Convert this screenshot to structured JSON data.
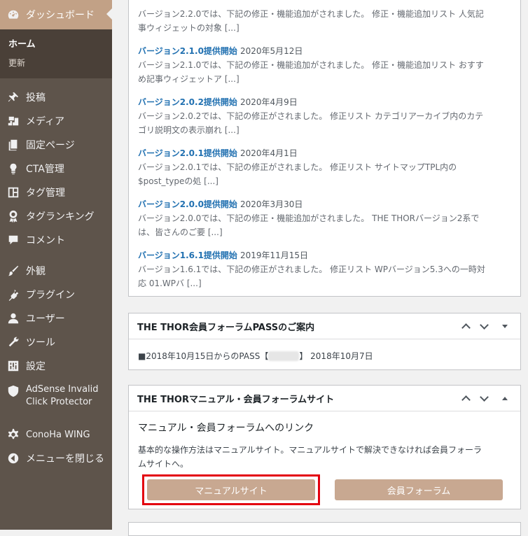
{
  "sidebar": {
    "dashboard": "ダッシュボード",
    "sub_home": "ホーム",
    "sub_update": "更新",
    "items": [
      {
        "label": "投稿",
        "icon": "pin-icon"
      },
      {
        "label": "メディア",
        "icon": "media-icon"
      },
      {
        "label": "固定ページ",
        "icon": "page-icon"
      },
      {
        "label": "CTA管理",
        "icon": "lightbulb-icon"
      },
      {
        "label": "タグ管理",
        "icon": "tag-icon"
      },
      {
        "label": "タグランキング",
        "icon": "award-icon"
      },
      {
        "label": "コメント",
        "icon": "comment-icon"
      },
      {
        "label": "外観",
        "icon": "brush-icon"
      },
      {
        "label": "プラグイン",
        "icon": "plugin-icon"
      },
      {
        "label": "ユーザー",
        "icon": "user-icon"
      },
      {
        "label": "ツール",
        "icon": "wrench-icon"
      },
      {
        "label": "設定",
        "icon": "settings-icon"
      },
      {
        "label_line1": "AdSense Invalid",
        "label_line2": "Click Protector",
        "icon": "shield-icon"
      },
      {
        "label": "ConoHa WING",
        "icon": "gear-icon"
      },
      {
        "label": "メニューを閉じる",
        "icon": "collapse-icon"
      }
    ]
  },
  "news": {
    "top_excerpt_line1": "バージョン2.2.0では、下記の修正・機能追加がされました。 修正・機能追加リスト 人気記",
    "top_excerpt_line2": "事ウィジェットの対象 [...]",
    "items": [
      {
        "title": "バージョン2.1.0提供開始",
        "date": "2020年5月12日",
        "line1": "バージョン2.1.0では、下記の修正・機能追加がされました。 修正・機能追加リスト おすす",
        "line2": "め記事ウィジェットア [...]"
      },
      {
        "title": "バージョン2.0.2提供開始",
        "date": "2020年4月9日",
        "line1": "バージョン2.0.2では、下記の修正がされました。 修正リスト カテゴリアーカイブ内のカテ",
        "line2": "ゴリ説明文の表示崩れ [...]"
      },
      {
        "title": "バージョン2.0.1提供開始",
        "date": "2020年4月1日",
        "line1": "バージョン2.0.1では、下記の修正がされました。 修正リスト サイトマップTPL内の",
        "line2": "$post_typeの処 [...]"
      },
      {
        "title": "バージョン2.0.0提供開始",
        "date": "2020年3月30日",
        "line1": "バージョン2.0.0では、下記の修正・機能追加がされました。 THE THORバージョン2系で",
        "line2": "は、皆さんのご要 [...]"
      },
      {
        "title": "バージョン1.6.1提供開始",
        "date": "2019年11月15日",
        "line1": "バージョン1.6.1では、下記の修正がされました。 修正リスト WPバージョン5.3への一時対",
        "line2": "応 01.WPバ [...]"
      }
    ]
  },
  "pass_panel": {
    "title": "THE THOR会員フォーラムPASSのご案内",
    "text_before": "■2018年10月15日からのPASS【",
    "text_after": "】 2018年10月7日"
  },
  "manual_panel": {
    "title": "THE THORマニュアル・会員フォーラムサイト",
    "subtitle": "マニュアル・会員フォーラムへのリンク",
    "description_line1": "基本的な操作方法はマニュアルサイト。マニュアルサイトで解決できなければ会員フォーラ",
    "description_line2": "ムサイトへ。",
    "btn_manual": "マニュアルサイト",
    "btn_forum": "会員フォーラム"
  },
  "colors": {
    "sidebar_bg": "#5e544b",
    "accent": "#c2a186",
    "button": "#c8a891",
    "highlight": "#e3000f",
    "link": "#2271b1"
  }
}
